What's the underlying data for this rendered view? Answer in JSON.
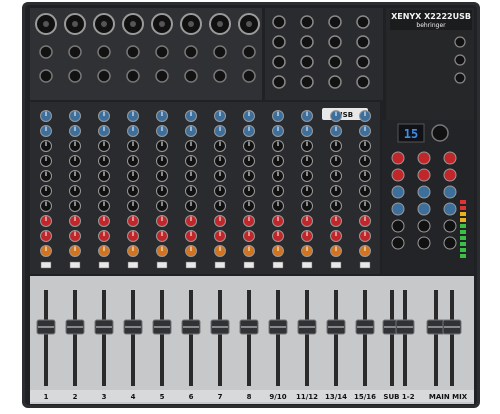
{
  "brand": "behringer",
  "model": "XENYX X2222USB",
  "strip_numbers": [
    "1",
    "2",
    "3",
    "4",
    "5",
    "6",
    "7",
    "8",
    "9/10",
    "11/12",
    "13/14",
    "15/16"
  ],
  "bus_labels": {
    "sub": "SUB 1-2",
    "main": "MAIN MIX"
  },
  "usb_label": "USB",
  "fx_display_value": "15",
  "colors": {
    "chassis": "#2b2b2e",
    "faceplate": "#1e1e20",
    "strip_panel": "#27282b",
    "fader_bed": "#c9cbcd",
    "knob_blue": "#3d6f9c",
    "knob_red": "#c0262a",
    "knob_orange": "#d2731f",
    "lcd_blue": "#2f78c8"
  }
}
